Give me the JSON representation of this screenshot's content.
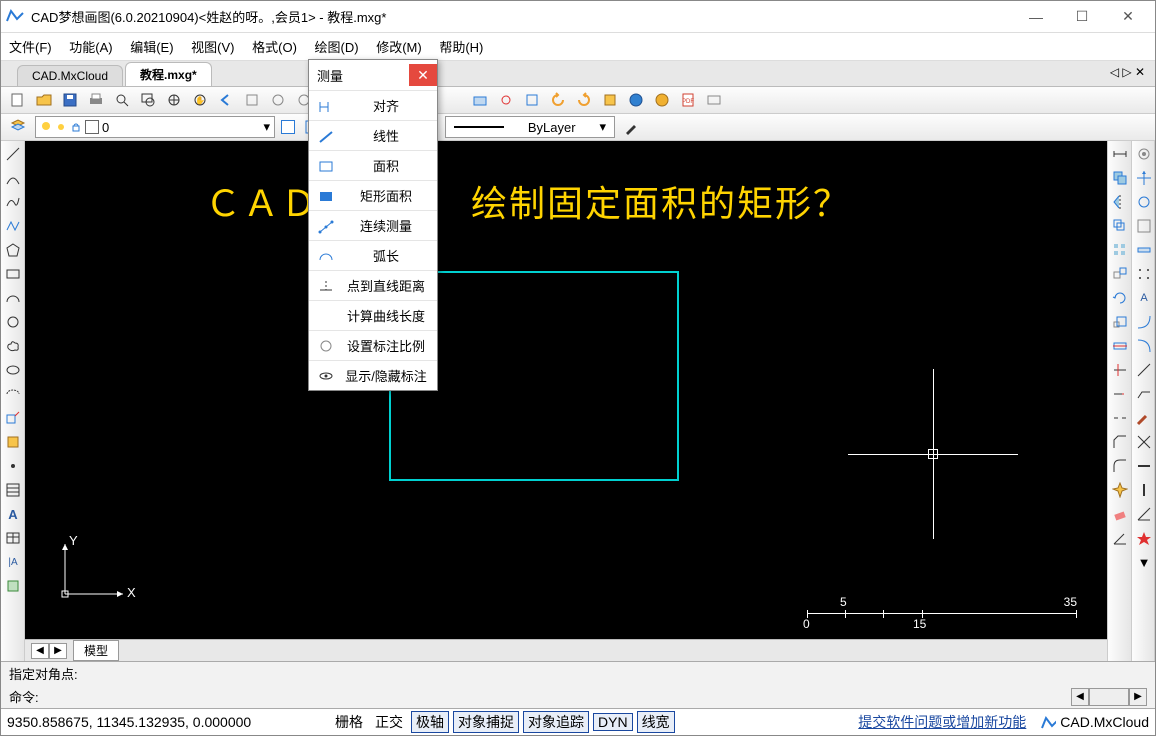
{
  "window": {
    "title": "CAD梦想画图(6.0.20210904)<姓赵的呀。,会员1> - 教程.mxg*",
    "min": "—",
    "max": "☐",
    "close": "✕"
  },
  "menu": {
    "file": "文件(F)",
    "func": "功能(A)",
    "edit": "编辑(E)",
    "view": "视图(V)",
    "format": "格式(O)",
    "draw": "绘图(D)",
    "modify": "修改(M)",
    "help": "帮助(H)"
  },
  "tabs": {
    "t1": "CAD.MxCloud",
    "t2": "教程.mxg*",
    "nav": "◁ ▷ ✕"
  },
  "prop": {
    "layer_value": "0",
    "bylayer": "ByLayer"
  },
  "canvas": {
    "overlay_text": "ＣＡＤ如　　　绘制固定面积的矩形？",
    "ucs_x": "X",
    "ucs_y": "Y",
    "ruler": {
      "v0": "0",
      "v5": "5",
      "v15": "15",
      "v35": "35"
    }
  },
  "popup": {
    "title": "测量",
    "items": [
      "对齐",
      "线性",
      "面积",
      "矩形面积",
      "连续测量",
      "弧长",
      "点到直线距离",
      "计算曲线长度",
      "设置标注比例",
      "显示/隐藏标注"
    ]
  },
  "canvas_tab": {
    "model": "模型",
    "left": "◀",
    "right": "▶"
  },
  "cmd": {
    "last": "指定对角点:",
    "prompt": "命令:",
    "input": ""
  },
  "status": {
    "coord": "9350.858675, 11345.132935, 0.000000",
    "grid": "栅格",
    "ortho": "正交",
    "polar": "极轴",
    "osnap": "对象捕捉",
    "otrack": "对象追踪",
    "dyn": "DYN",
    "lw": "线宽",
    "link": "提交软件问题或增加新功能",
    "cloud": "CAD.MxCloud"
  }
}
